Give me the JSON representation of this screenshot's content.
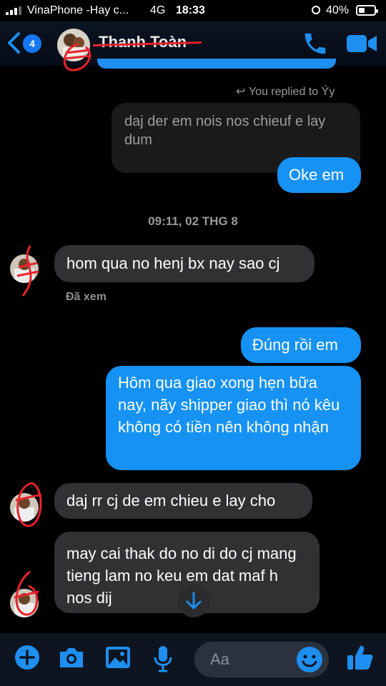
{
  "status_bar": {
    "carrier": "VinaPhone -Hay c...",
    "network": "4G",
    "time": "18:33",
    "battery_percent": "40%",
    "battery_level": 0.4
  },
  "header": {
    "back_badge": "4",
    "contact_name": "Thanh Toàn"
  },
  "conversation": {
    "reply_indicator": "You replied to Ýy",
    "quoted_message": "daj der em nois nos chieuf e lay dum",
    "reply_message": "Oke em",
    "timestamp": "09:11, 02 THG 8",
    "messages": [
      {
        "direction": "in",
        "text": "hom qua no henj bx nay sao cj"
      },
      {
        "direction": "out",
        "text": "Đúng rồi em"
      },
      {
        "direction": "out",
        "text": "Hôm qua giao xong hẹn bữa nay, nãy shipper giao thì nó kêu không có tiền nên không nhận"
      },
      {
        "direction": "in",
        "text": "daj rr cj de em chieu e lay cho"
      },
      {
        "direction": "in",
        "text": "may cai thak do no di do cj mang tieng lam no keu em dat maf h nos dij"
      }
    ],
    "seen_label": "Đã xem"
  },
  "composer": {
    "placeholder": "Aa"
  },
  "colors": {
    "accent": "#1592f4",
    "incoming_bubble": "#313133",
    "redaction": "#e8232b"
  },
  "icons": [
    "back-chevron-icon",
    "phone-icon",
    "video-camera-icon",
    "scroll-down-arrow-icon",
    "plus-icon",
    "camera-icon",
    "image-icon",
    "microphone-icon",
    "emoji-icon",
    "thumbs-up-icon"
  ]
}
